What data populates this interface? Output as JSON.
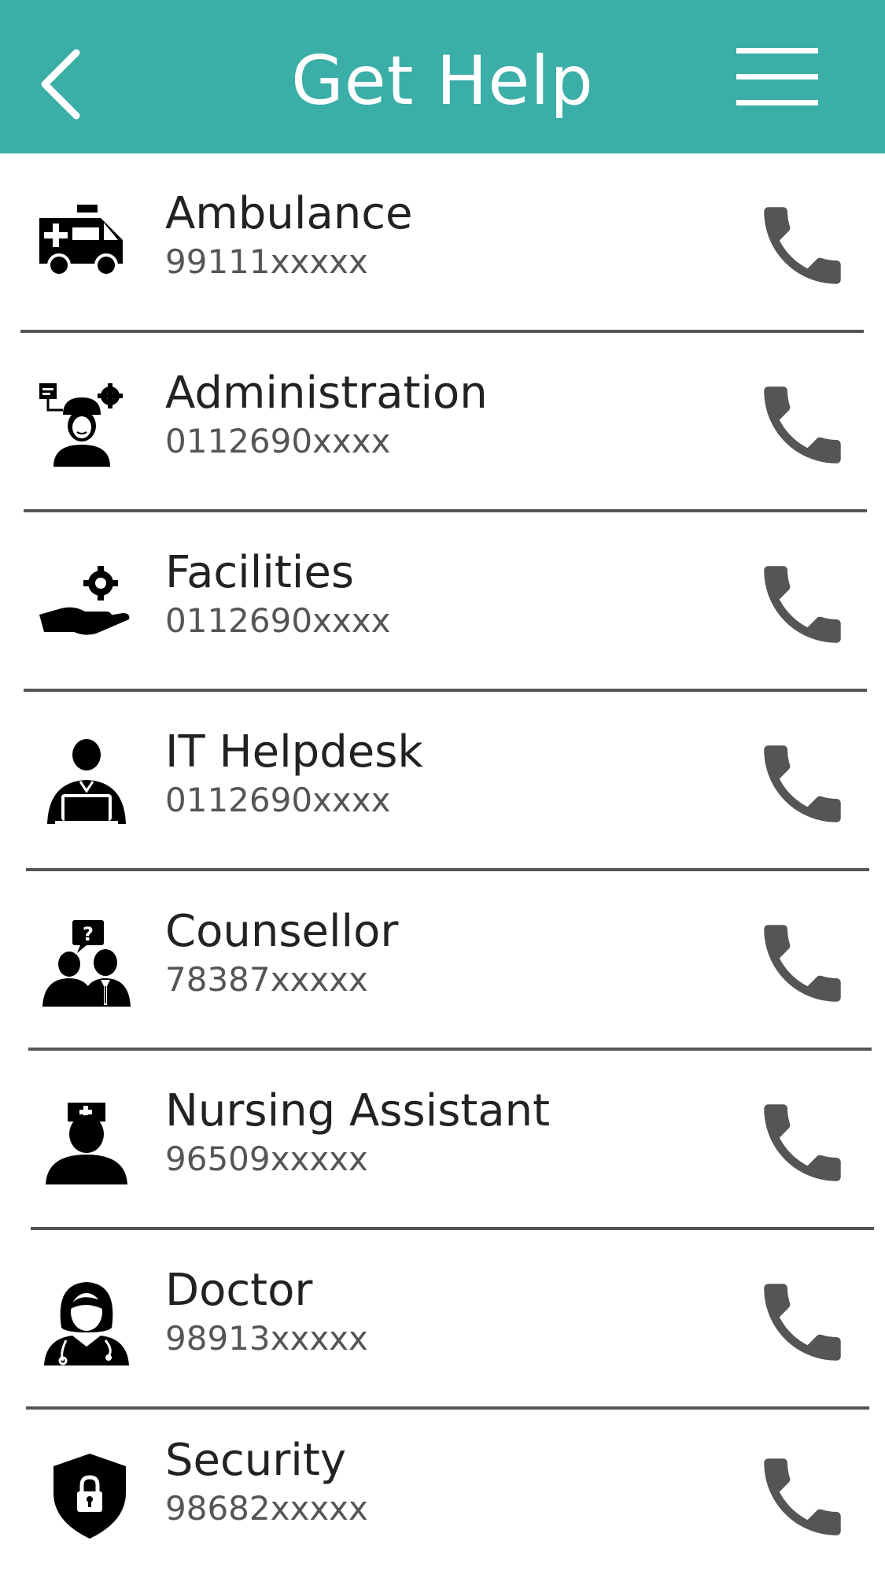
{
  "header": {
    "title": "Get Help",
    "color": "#3aaea7",
    "back_icon": "chevron-left-icon",
    "menu_icon": "hamburger-menu-icon"
  },
  "contacts": [
    {
      "name": "Ambulance",
      "number": "99111xxxxx",
      "icon": "ambulance-icon"
    },
    {
      "name": "Administration",
      "number": "0112690xxxx",
      "icon": "administrator-icon"
    },
    {
      "name": "Facilities",
      "number": "0112690xxxx",
      "icon": "facilities-icon"
    },
    {
      "name": "IT Helpdesk",
      "number": "0112690xxxx",
      "icon": "it-helpdesk-icon"
    },
    {
      "name": "Counsellor",
      "number": "78387xxxxx",
      "icon": "counsellor-icon"
    },
    {
      "name": "Nursing Assistant",
      "number": "96509xxxxx",
      "icon": "nurse-icon"
    },
    {
      "name": "Doctor",
      "number": "98913xxxxx",
      "icon": "doctor-icon"
    },
    {
      "name": "Security",
      "number": "98682xxxxx",
      "icon": "security-shield-icon"
    }
  ],
  "call_icon": "phone-call-icon"
}
